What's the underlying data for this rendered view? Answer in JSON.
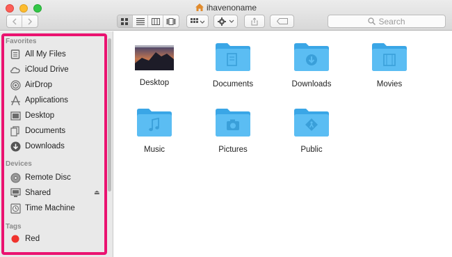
{
  "window": {
    "title": "ihavenoname"
  },
  "toolbar": {
    "back_icon": "chevron-left-icon",
    "forward_icon": "chevron-right-icon",
    "view_modes": [
      "icon-view-icon",
      "list-view-icon",
      "column-view-icon",
      "cover-flow-icon"
    ],
    "arrange_icon": "arrange-grid-icon",
    "action_icon": "gear-icon",
    "share_icon": "share-icon",
    "tag_icon": "tag-icon",
    "search_placeholder": "Search"
  },
  "sidebar": {
    "favorites_header": "Favorites",
    "favorites": [
      {
        "label": "All My Files",
        "icon": "all-files-icon"
      },
      {
        "label": "iCloud Drive",
        "icon": "cloud-icon"
      },
      {
        "label": "AirDrop",
        "icon": "airdrop-icon"
      },
      {
        "label": "Applications",
        "icon": "applications-icon"
      },
      {
        "label": "Desktop",
        "icon": "desktop-icon"
      },
      {
        "label": "Documents",
        "icon": "documents-icon"
      },
      {
        "label": "Downloads",
        "icon": "downloads-icon"
      }
    ],
    "devices_header": "Devices",
    "devices": [
      {
        "label": "Remote Disc",
        "icon": "disc-icon"
      },
      {
        "label": "Shared",
        "icon": "shared-icon",
        "eject": "⏏"
      },
      {
        "label": "Time Machine",
        "icon": "time-machine-icon"
      }
    ],
    "tags_header": "Tags",
    "tags": [
      {
        "label": "Red",
        "color": "#f0332d"
      }
    ],
    "highlight_color": "#ea1370"
  },
  "files": [
    {
      "label": "Desktop",
      "type": "desktop-thumbnail"
    },
    {
      "label": "Documents",
      "type": "folder-documents-icon"
    },
    {
      "label": "Downloads",
      "type": "folder-downloads-icon"
    },
    {
      "label": "Movies",
      "type": "folder-movies-icon"
    },
    {
      "label": "Music",
      "type": "folder-music-icon"
    },
    {
      "label": "Pictures",
      "type": "folder-pictures-icon"
    },
    {
      "label": "Public",
      "type": "folder-public-icon"
    }
  ],
  "colors": {
    "folder": "#5bbdf3",
    "folder_dark": "#3aa6e6",
    "accent": "#ea1370"
  }
}
